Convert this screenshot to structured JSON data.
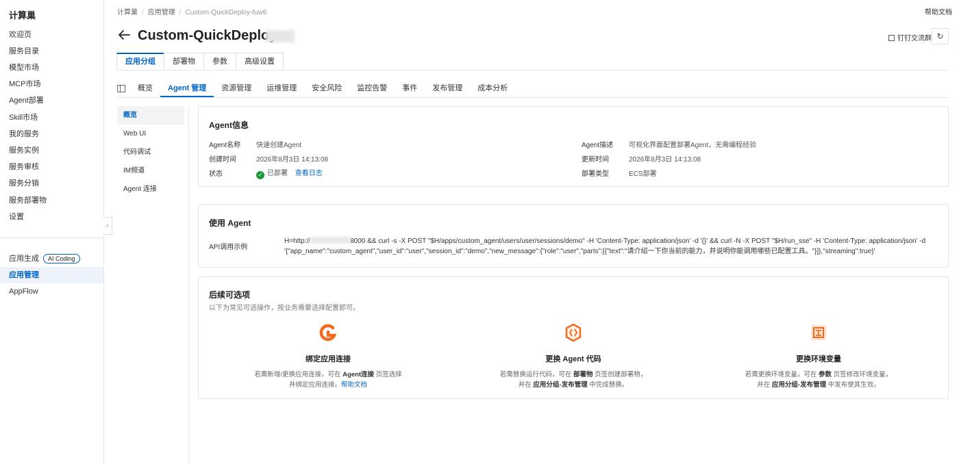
{
  "sidebar": {
    "brand": "计算巢",
    "items": [
      "欢迎页",
      "服务目录",
      "模型市场",
      "MCP市场",
      "Agent部署",
      "Skill市场",
      "我的服务",
      "服务实例",
      "服务审核",
      "服务分销",
      "服务部署物",
      "设置"
    ],
    "items2": [
      {
        "label": "应用生成",
        "badge": "AI Coding"
      },
      {
        "label": "应用管理",
        "active": true
      },
      {
        "label": "AppFlow"
      }
    ]
  },
  "header": {
    "breadcrumb": [
      "计算巢",
      "应用管理",
      "Custom-QuickDeploy-fuw6"
    ],
    "help": "帮助文档",
    "title": "Custom-QuickDeploy-",
    "dingtalk": "钉钉交流群"
  },
  "top_tabs": [
    "应用分组",
    "部署物",
    "参数",
    "高级设置"
  ],
  "sub_tabs": [
    "概览",
    "Agent 管理",
    "资源管理",
    "运维管理",
    "安全风险",
    "监控告警",
    "事件",
    "发布管理",
    "成本分析"
  ],
  "inner_menu": [
    "概览",
    "Web UI",
    "代码调试",
    "IM频道",
    "Agent 连接"
  ],
  "agent_info": {
    "title": "Agent信息",
    "name_label": "Agent名称",
    "name": "快速创建Agent",
    "created_label": "创建时间",
    "created": "2026年8月3日 14:13:08",
    "status_label": "状态",
    "status": "已部署",
    "log_link": "查看日志",
    "desc_label": "Agent描述",
    "desc": "可视化界面配置部署Agent，无需编程经验",
    "updated_label": "更新时间",
    "updated": "2026年8月3日 14:13:08",
    "deploy_label": "部署类型",
    "deploy": "ECS部署"
  },
  "use_agent": {
    "title": "使用 Agent",
    "api_label": "API调用示例",
    "api_prefix": "H=http://",
    "api_rest": "8000 && curl -s -X POST \"$H/apps/custom_agent/users/user/sessions/demo\" -H 'Content-Type: application/json' -d '{}' && curl -N -X POST \"$H/run_sse\" -H 'Content-Type: application/json' -d '{\"app_name\":\"custom_agent\",\"user_id\":\"user\",\"session_id\":\"demo\",\"new_message\":{\"role\":\"user\",\"parts\":[{\"text\":\"请介绍一下你当前的能力，并说明你能调用哪些已配置工具。\"}]},\"streaming\":true}'"
  },
  "options": {
    "title": "后续可选项",
    "desc": "以下为常见可选操作，按业务需要选择配置即可。",
    "items": [
      {
        "title": "绑定应用连接",
        "l1a": "若需新增/更换应用连接，可在 ",
        "l1b": "Agent连接",
        "l1c": " 页签选择",
        "l2a": "并绑定应用连接。",
        "link": "帮助文档"
      },
      {
        "title": "更换 Agent 代码",
        "l1a": "若需替换运行代码，可在 ",
        "l1b": "部署物",
        "l1c": " 页签创建部署物，",
        "l2a": "并在 ",
        "l2b": "应用分组-发布管理",
        "l2c": " 中完成替换。"
      },
      {
        "title": "更换环境变量",
        "l1a": "若需更换环境变量，可在 ",
        "l1b": "参数",
        "l1c": " 页签修改环境变量，",
        "l2a": "并在 ",
        "l2b": "应用分组-发布管理",
        "l2c": " 中发布使其生效。"
      }
    ]
  },
  "colors": {
    "accent": "#0064c8",
    "success": "#1e9b3b",
    "icon_orange": "#f26a1b"
  }
}
